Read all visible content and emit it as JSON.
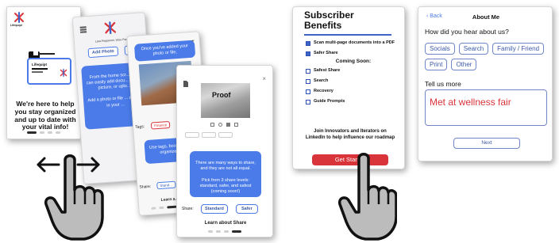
{
  "colors": {
    "accent_blue": "#4a7be8",
    "brand_red": "#d9343a",
    "text_dark": "#1a1a1a",
    "pill_border": "#6f86c8"
  },
  "onboarding": {
    "screen1": {
      "logo_label": "Lifequipt",
      "card_label": "Lifequipt",
      "message": "We're here to help you stay organized and up to date with your vital info!"
    },
    "screen2": {
      "header_text": "Lara Pepperoni, Wiss Pass",
      "add_photo_label": "Add Photo",
      "second_button_label": "A",
      "bubble_text": "From the home scr... you can easily add docu... take a picture, or uplo...",
      "bubble_text_2": "Add a photo or file ... appear in your ..."
    },
    "screen3": {
      "bubble_top": "Once you've added your photo or file,",
      "tags_label": "Tags:",
      "tag_value": "Finance",
      "bubble_mid": "Use tags, bookmarks... organize d...",
      "share_label": "Share:",
      "share_value": "Stand...",
      "learn_label": "Learn a..."
    },
    "screen4": {
      "proof_label": "Proof",
      "bubble_text": "There are many ways to share, and they are not all equal.\n\nPick from 3 share levels: standard, safer, and safest (coming soon!)",
      "share_label": "Share:",
      "standard_label": "Standard",
      "safer_label": "Safer",
      "learn_label": "Learn about Share"
    }
  },
  "benefits": {
    "title": "Subscriber Benefits",
    "items": [
      {
        "label": "Scan multi-page documents into a PDF",
        "checked": true
      },
      {
        "label": "Safer Share",
        "checked": true
      }
    ],
    "coming_soon_label": "Coming Soon:",
    "coming_items": [
      {
        "label": "Safest Share",
        "checked": false
      },
      {
        "label": "Search",
        "checked": false
      },
      {
        "label": "Recovery",
        "checked": false
      },
      {
        "label": "Guide Prompts",
        "checked": false
      }
    ],
    "join_text": "Join Innovators and Iterators on LinkedIn to help influence our roadmap",
    "cta_label": "Get Started"
  },
  "about": {
    "back_label": "Back",
    "title": "About Me",
    "question": "How did you hear about us?",
    "options": [
      "Socials",
      "Search",
      "Family / Friend",
      "Print",
      "Other"
    ],
    "tell_label": "Tell us more",
    "tell_value": "Met at wellness fair",
    "next_label": "Next"
  },
  "icons": {
    "swipe_arrow": "left-right-arrow-icon",
    "hand": "pointing-hand-icon",
    "logo": "lifequipt-logo-icon"
  }
}
